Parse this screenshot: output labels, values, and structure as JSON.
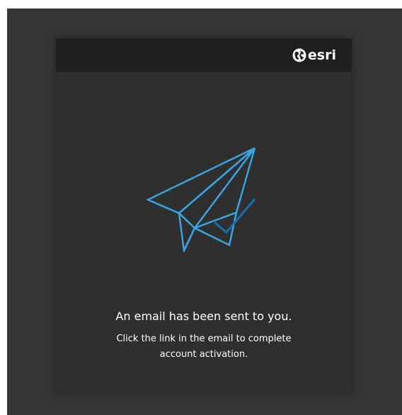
{
  "brand": {
    "name": "esri",
    "logo_icon": "globe-icon"
  },
  "illustration": {
    "icon": "paper-plane-check-icon",
    "colors": {
      "plane": "#3aa4e0",
      "check": "#1a6fa8"
    }
  },
  "message": {
    "title": "An email has been sent to you.",
    "line1": "Click the link in the email to complete",
    "line2": "account activation."
  },
  "colors": {
    "background": "#363636",
    "card": "#2f2f2f",
    "header": "#1f1f1f",
    "text": "#ffffff"
  }
}
